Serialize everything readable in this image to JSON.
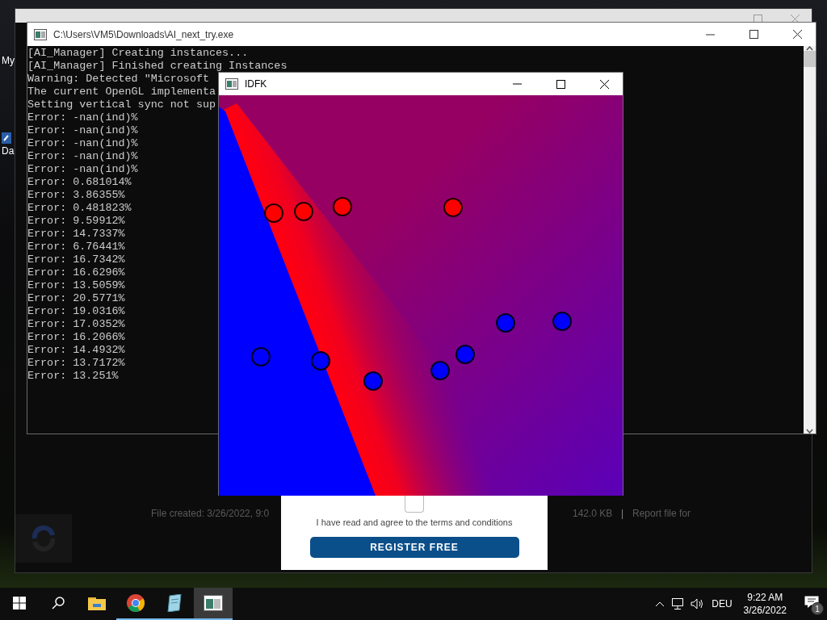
{
  "desktop": {
    "icons": [
      {
        "label": "My"
      },
      {
        "label": "Da"
      }
    ]
  },
  "background_window": {
    "file_info": {
      "created": "File created: 3/26/2022, 9:0",
      "size": "142.0 KB",
      "separator": "|",
      "report_link": "Report file for"
    },
    "form": {
      "checkbox": {
        "checked": false
      },
      "terms_label": "I have read and agree to the terms and conditions",
      "button": "REGISTER FREE"
    }
  },
  "console_window": {
    "title": "C:\\Users\\VM5\\Downloads\\AI_next_try.exe",
    "lines": [
      "[AI_Manager] Creating instances...",
      "[AI_Manager] Finished creating Instances",
      "Warning: Detected \"Microsoft",
      "The current OpenGL implementa",
      "Setting vertical sync not sup",
      "Error: -nan(ind)%",
      "Error: -nan(ind)%",
      "Error: -nan(ind)%",
      "Error: -nan(ind)%",
      "Error: -nan(ind)%",
      "Error: 0.681014%",
      "Error: 3.86355%",
      "Error: 0.481823%",
      "Error: 9.59912%",
      "Error: 14.7337%",
      "Error: 6.76441%",
      "Error: 16.7342%",
      "Error: 16.6296%",
      "Error: 13.5059%",
      "Error: 20.5771%",
      "Error: 19.0316%",
      "Error: 17.0352%",
      "Error: 16.2066%",
      "Error: 14.4932%",
      "Error: 13.7172%",
      "Error: 13.251%"
    ]
  },
  "render_window": {
    "title": "IDFK"
  },
  "taskbar": {
    "apps": [
      {
        "kind": "folder",
        "running": false,
        "selected": false
      },
      {
        "kind": "browser",
        "running": true,
        "selected": false
      },
      {
        "kind": "notepad",
        "running": true,
        "selected": false
      },
      {
        "kind": "console",
        "running": true,
        "selected": true
      }
    ],
    "tray": {
      "language": "DEU",
      "time": "9:22 AM",
      "date": "3/26/2022",
      "notifications": "1"
    }
  }
}
